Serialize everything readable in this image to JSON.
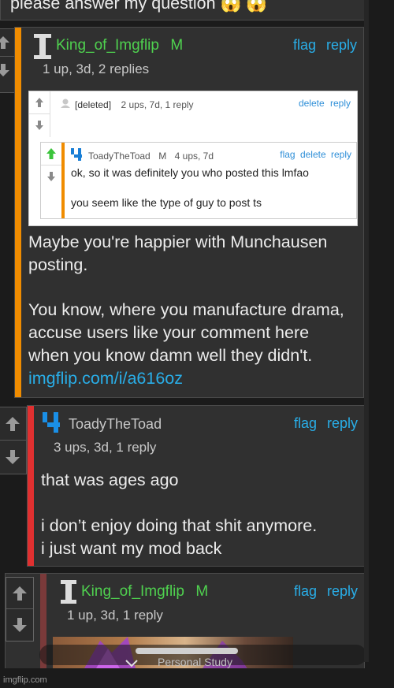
{
  "top": {
    "text": "please answer my question",
    "emojis": "😱 😱"
  },
  "comment1": {
    "username": "King_of_Imgflip",
    "badge": "M",
    "meta": "1 up, 3d, 2 replies",
    "flag": "flag",
    "reply": "reply",
    "paragraph1": "Maybe you're happier with Munchausen posting.",
    "paragraph2": "You know, where you manufacture drama, accuse users like your comment here when you know damn well they didn't.",
    "link": "imgflip.com/i/a616oz",
    "stripe_color": "#f08c00"
  },
  "embedded": {
    "deleted": {
      "username": "[deleted]",
      "meta": "2 ups, 7d, 1 reply",
      "delete": "delete",
      "reply": "reply"
    },
    "toad": {
      "username": "ToadyTheToad",
      "badge": "M",
      "meta": "4 ups, 7d",
      "flag": "flag",
      "delete": "delete",
      "reply": "reply",
      "line1": "ok, so it was definitely you who posted this lmfao",
      "line2": "you seem like the type of guy to post ts"
    }
  },
  "comment2": {
    "username": "ToadyTheToad",
    "meta": "3 ups, 3d, 1 reply",
    "flag": "flag",
    "reply": "reply",
    "line1": "that was ages ago",
    "line2": "i don’t enjoy doing that shit anymore.",
    "line3": "i just want my mod back",
    "stripe_color": "#e03030"
  },
  "comment3": {
    "username": "King_of_Imgflip",
    "badge": "M",
    "meta": "1 up, 3d, 1 reply",
    "flag": "flag",
    "reply": "reply",
    "image_caption": "Personal Study",
    "stripe_color": "#7a3a3a"
  },
  "watermark": "imgflip.com",
  "colors": {
    "username": "#4fd14f",
    "link": "#29aee8",
    "upvote_active": "#3cc43c"
  }
}
